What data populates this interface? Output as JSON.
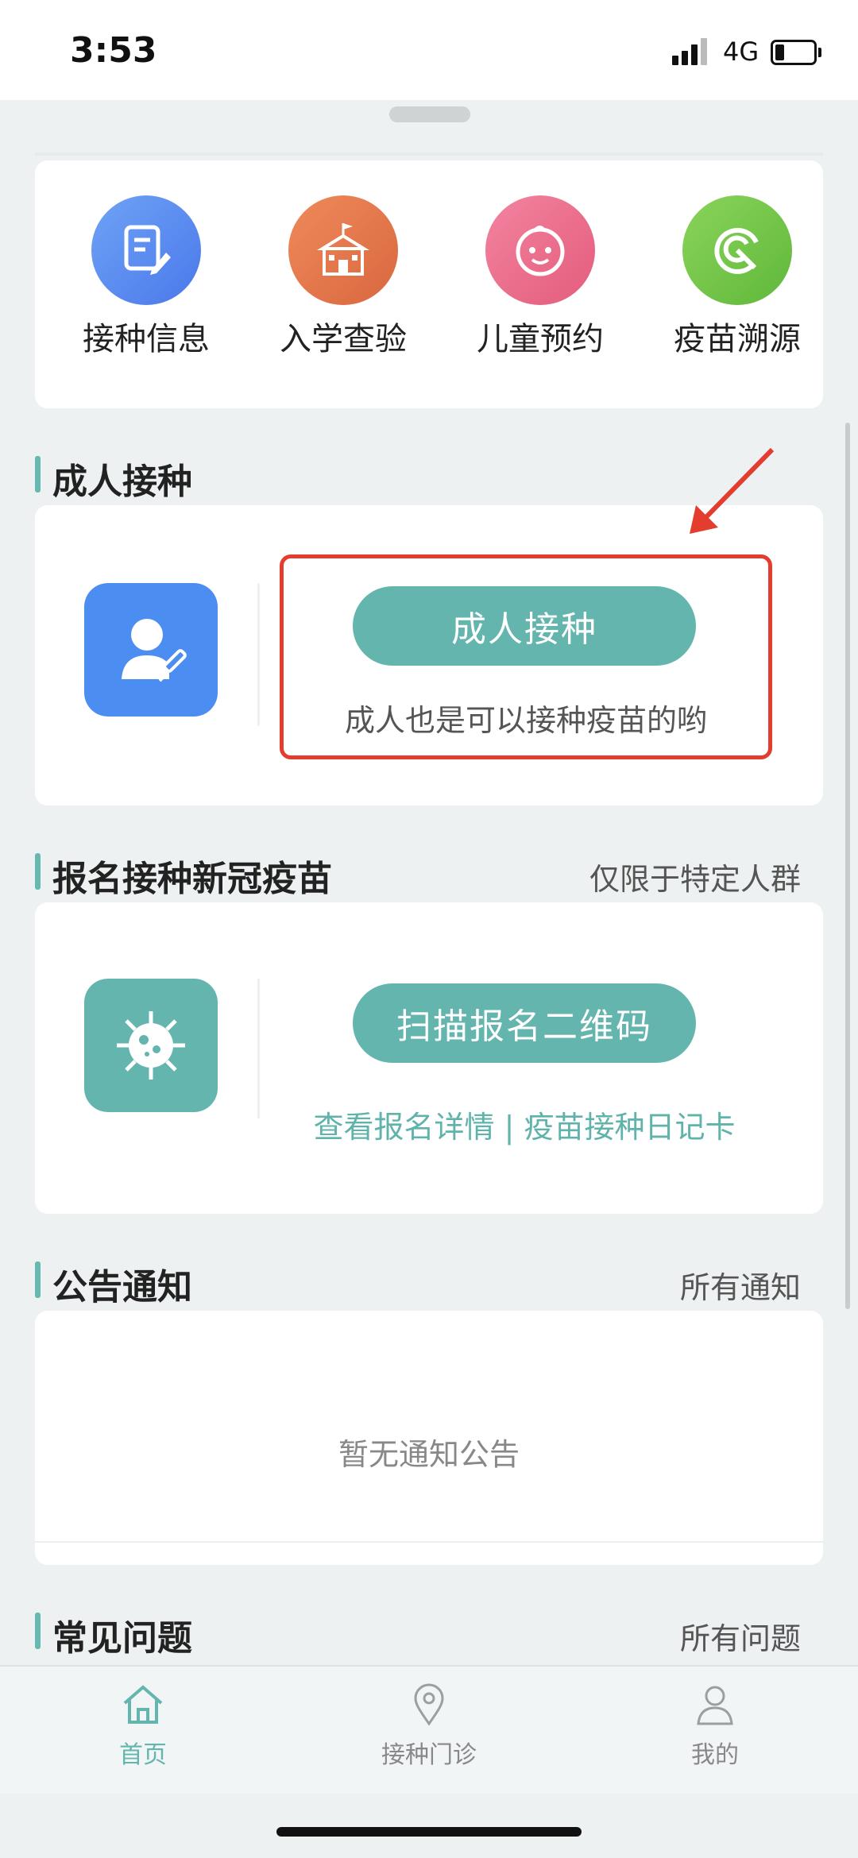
{
  "status": {
    "time": "3:53",
    "network": "4G"
  },
  "quick_links": [
    {
      "label": "接种信息",
      "icon": "document-edit-icon",
      "color": "#5b8ef2"
    },
    {
      "label": "入学查验",
      "icon": "school-icon",
      "color": "#e57a4e"
    },
    {
      "label": "儿童预约",
      "icon": "baby-face-icon",
      "color": "#ec6e8c"
    },
    {
      "label": "疫苗溯源",
      "icon": "trace-icon",
      "color": "#76c94a"
    }
  ],
  "adult": {
    "section_title": "成人接种",
    "button": "成人接种",
    "subtitle": "成人也是可以接种疫苗的哟",
    "icon": "adult-vaccination-icon"
  },
  "covid": {
    "section_title": "报名接种新冠疫苗",
    "section_right": "仅限于特定人群",
    "button": "扫描报名二维码",
    "link_details": "查看报名详情",
    "link_separator": "|",
    "link_diary": "疫苗接种日记卡",
    "icon": "virus-icon"
  },
  "notices": {
    "section_title": "公告通知",
    "section_right": "所有通知",
    "empty_text": "暂无通知公告"
  },
  "faq": {
    "section_title": "常见问题",
    "section_right": "所有问题"
  },
  "nav": [
    {
      "label": "首页",
      "icon": "home-icon",
      "active": true
    },
    {
      "label": "接种门诊",
      "icon": "location-pin-icon",
      "active": false
    },
    {
      "label": "我的",
      "icon": "user-icon",
      "active": false
    }
  ],
  "colors": {
    "accent": "#63b5ad",
    "highlight_box": "#e23d2e"
  }
}
